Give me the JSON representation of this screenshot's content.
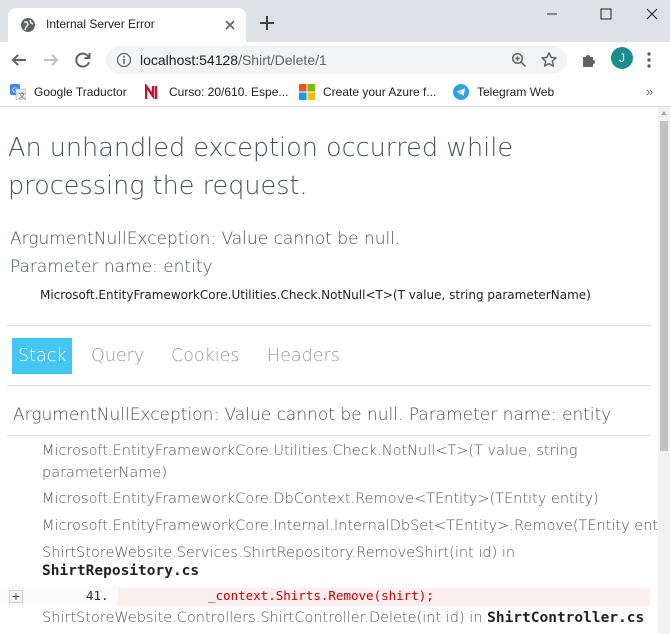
{
  "browser": {
    "tab_title": "Internal Server Error",
    "url_host": "localhost:54128",
    "url_path": "/Shirt/Delete/1",
    "avatar_letter": "J",
    "bookmarks": [
      {
        "label": "Google Traductor",
        "icon": "google-translate-icon"
      },
      {
        "label": "Curso: 20/610. Espe...",
        "icon": "ni-logo-icon"
      },
      {
        "label": "Create your Azure f...",
        "icon": "microsoft-logo-icon"
      },
      {
        "label": "Telegram Web",
        "icon": "telegram-icon"
      }
    ],
    "bookmarks_more": "»"
  },
  "page": {
    "title": "An unhandled exception occurred while processing the request.",
    "exception_type": "ArgumentNullException: Value cannot be null.",
    "exception_param": "Parameter name: entity",
    "exception_location": "Microsoft.EntityFrameworkCore.Utilities.Check.NotNull<T>(T value, string parameterName)",
    "tabs": [
      "Stack",
      "Query",
      "Cookies",
      "Headers"
    ],
    "selected_tab": "Stack",
    "stack_title": "ArgumentNullException: Value cannot be null. Parameter name: entity",
    "frames": [
      {
        "method": "Microsoft.EntityFrameworkCore.Utilities.Check.NotNull<T>(T value, string parameterName)"
      },
      {
        "method": "Microsoft.EntityFrameworkCore.DbContext.Remove<TEntity>(TEntity entity)"
      },
      {
        "method": "Microsoft.EntityFrameworkCore.Internal.InternalDbSet<TEntity>.Remove(TEntity entity)"
      },
      {
        "method": "ShirtStoreWebsite.Services.ShirtRepository.RemoveShirt(int id) in",
        "file": "ShirtRepository.cs"
      },
      {
        "method": "ShirtStoreWebsite.Controllers.ShirtController.Delete(int id) in",
        "file": "ShirtController.cs"
      }
    ],
    "code": {
      "expander": "+",
      "line_number": "41.",
      "source": "_context.Shirts.Remove(shirt);"
    }
  },
  "colors": {
    "accent": "#44c5f2",
    "heading": "#44525e",
    "error_code": "#cc0000"
  }
}
